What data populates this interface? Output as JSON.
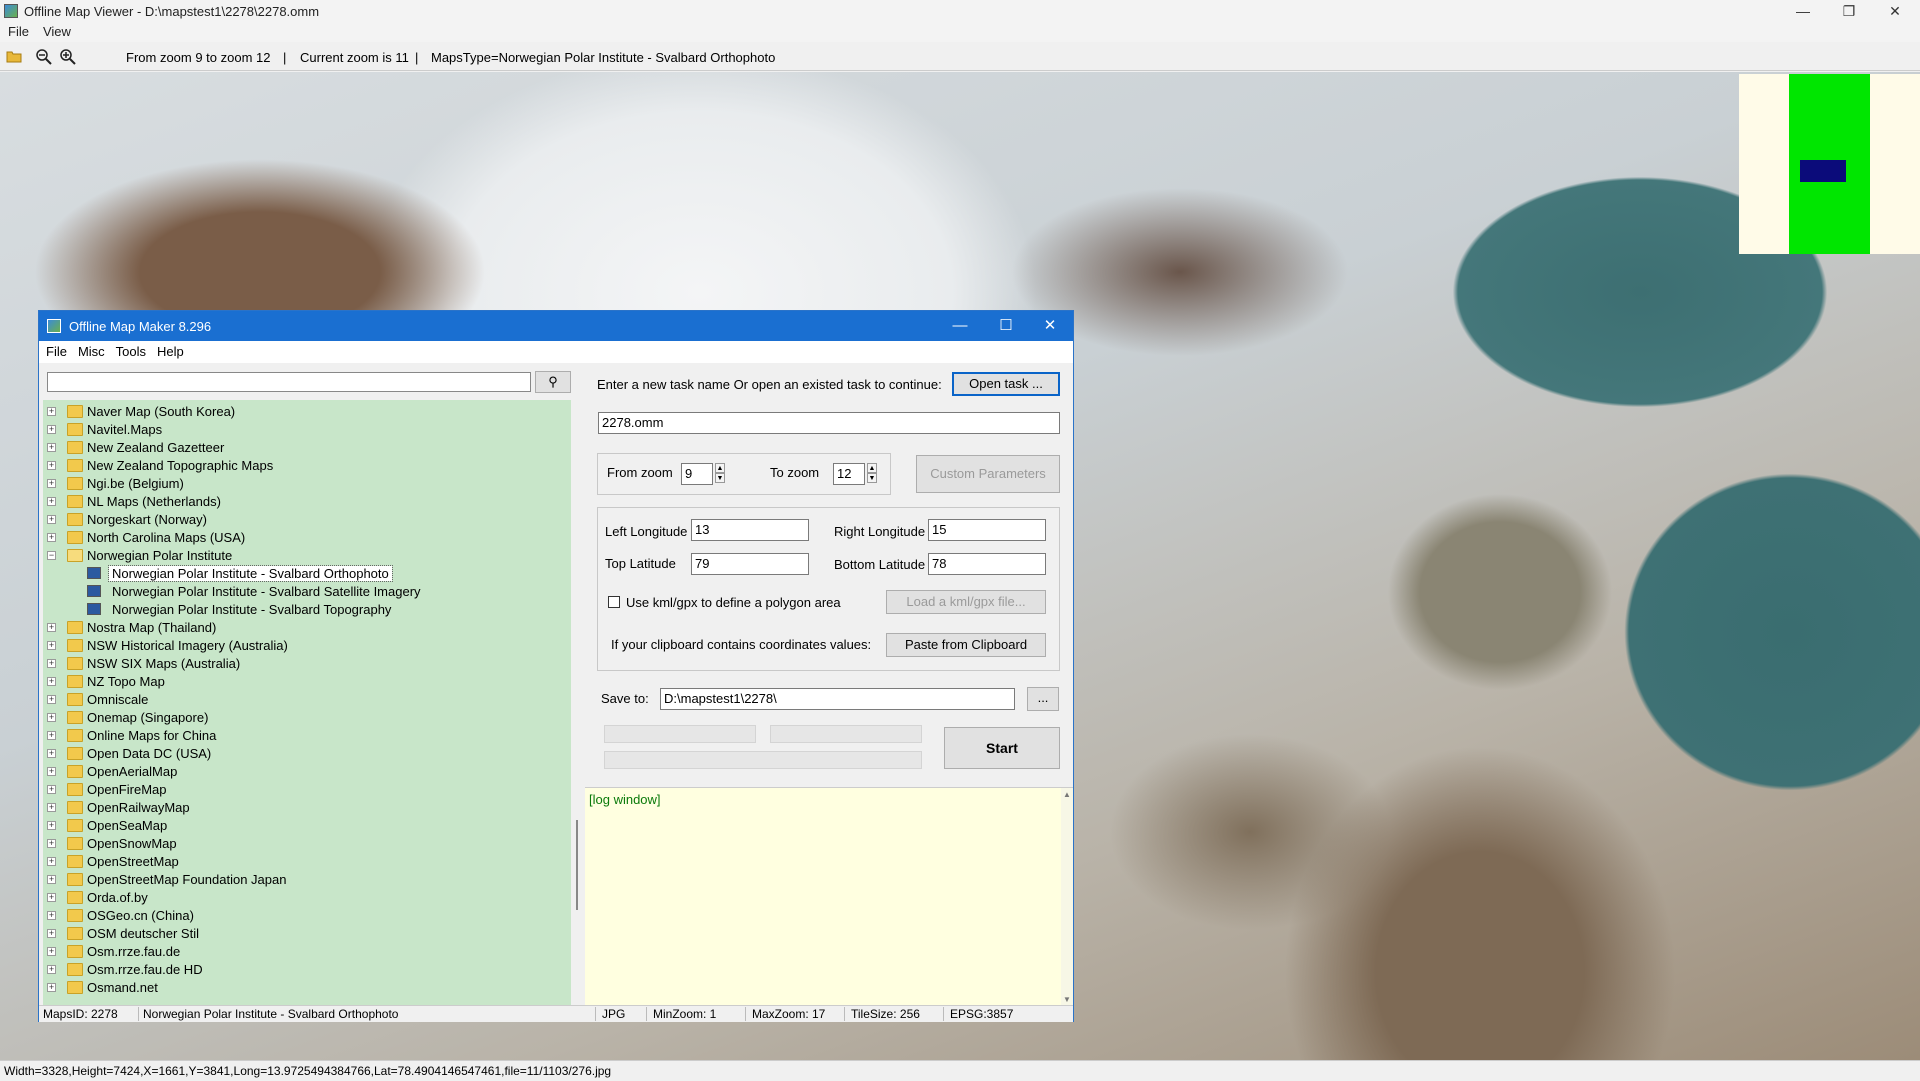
{
  "window": {
    "title": "Offline Map Viewer - D:\\mapstest1\\2278\\2278.omm",
    "controls": {
      "minimize": "—",
      "restore": "❐",
      "close": "✕"
    }
  },
  "menubar": [
    "File",
    "View"
  ],
  "toolbar": {
    "icons": [
      "open-folder-icon",
      "zoom-out-icon",
      "zoom-in-icon"
    ],
    "zoom_range": "From zoom 9 to zoom 12",
    "current_zoom": "Current zoom is 11",
    "maps_type": "MapsType=Norwegian Polar Institute - Svalbard Orthophoto",
    "sep": "|"
  },
  "statusbar": {
    "text": "Width=3328,Height=7424,X=1661,Y=3841,Long=13.9725494384766,Lat=78.4904146547461,file=11/1103/276.jpg"
  },
  "dialog": {
    "title": "Offline Map Maker 8.296",
    "controls": {
      "minimize": "—",
      "maximize": "☐",
      "close": "✕"
    },
    "menu": [
      "File",
      "Misc",
      "Tools",
      "Help"
    ],
    "search": {
      "value": "",
      "button_icon": "search-icon",
      "button_glyph": "⚲"
    },
    "tree": [
      {
        "label": "Naver Map (South Korea)"
      },
      {
        "label": "Navitel.Maps"
      },
      {
        "label": "New Zealand Gazetteer"
      },
      {
        "label": "New Zealand Topographic Maps"
      },
      {
        "label": "Ngi.be (Belgium)"
      },
      {
        "label": "NL Maps (Netherlands)"
      },
      {
        "label": "Norgeskart (Norway)"
      },
      {
        "label": "North Carolina Maps (USA)"
      },
      {
        "label": "Norwegian Polar Institute",
        "expanded": true
      },
      {
        "label": "Norwegian Polar Institute - Svalbard Orthophoto",
        "child": true,
        "selected": true
      },
      {
        "label": "Norwegian Polar Institute - Svalbard Satellite Imagery",
        "child": true
      },
      {
        "label": "Norwegian Polar Institute - Svalbard Topography",
        "child": true
      },
      {
        "label": "Nostra Map (Thailand)"
      },
      {
        "label": "NSW Historical Imagery (Australia)"
      },
      {
        "label": "NSW SIX Maps (Australia)"
      },
      {
        "label": "NZ Topo Map"
      },
      {
        "label": "Omniscale"
      },
      {
        "label": "Onemap (Singapore)"
      },
      {
        "label": "Online Maps for China"
      },
      {
        "label": "Open Data DC (USA)"
      },
      {
        "label": "OpenAerialMap"
      },
      {
        "label": "OpenFireMap"
      },
      {
        "label": "OpenRailwayMap"
      },
      {
        "label": "OpenSeaMap"
      },
      {
        "label": "OpenSnowMap"
      },
      {
        "label": "OpenStreetMap"
      },
      {
        "label": "OpenStreetMap Foundation Japan"
      },
      {
        "label": "Orda.of.by"
      },
      {
        "label": "OSGeo.cn (China)"
      },
      {
        "label": "OSM deutscher Stil"
      },
      {
        "label": "Osm.rrze.fau.de"
      },
      {
        "label": "Osm.rrze.fau.de HD"
      },
      {
        "label": "Osmand.net"
      }
    ],
    "task": {
      "prompt": "Enter a new task name Or open an existed task to continue:",
      "open_button": "Open task ...",
      "name": "2278.omm"
    },
    "zoom": {
      "from_label": "From zoom",
      "from_value": "9",
      "to_label": "To zoom",
      "to_value": "12",
      "custom_button": "Custom Parameters"
    },
    "coords": {
      "left_lon_label": "Left Longitude",
      "left_lon": "13",
      "right_lon_label": "Right Longitude",
      "right_lon": "15",
      "top_lat_label": "Top Latitude",
      "top_lat": "79",
      "bottom_lat_label": "Bottom Latitude",
      "bottom_lat": "78",
      "kml_label": "Use kml/gpx to define a polygon area",
      "kml_checked": false,
      "kml_button": "Load a kml/gpx file...",
      "clipboard_label": "If your clipboard contains coordinates values:",
      "clipboard_button": "Paste from Clipboard"
    },
    "save": {
      "label": "Save to:",
      "path": "D:\\mapstest1\\2278\\",
      "browse_button": "..."
    },
    "start_button": "Start",
    "log_title": "[log window]",
    "status": {
      "maps_id": "MapsID: 2278",
      "name": "Norwegian Polar Institute - Svalbard Orthophoto",
      "format": "JPG",
      "min_zoom": "MinZoom: 1",
      "max_zoom": "MaxZoom: 17",
      "tile_size": "TileSize: 256",
      "epsg": "EPSG:3857"
    }
  },
  "minimap": {
    "background": "#fffbe8",
    "area_color": "#00e600",
    "view_color": "#0b0b7a"
  }
}
